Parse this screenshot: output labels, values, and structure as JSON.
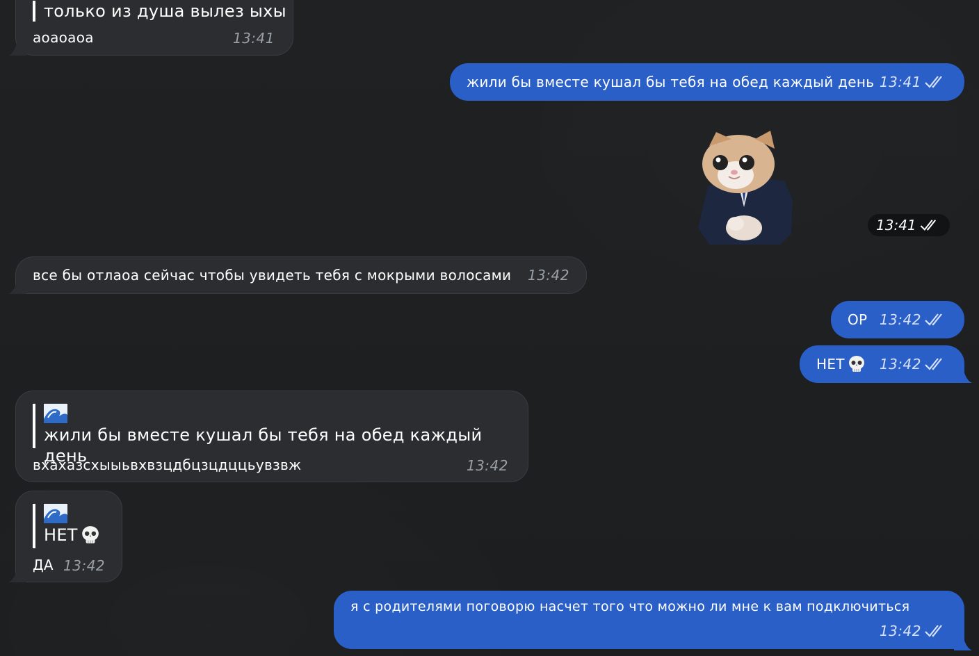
{
  "messages": [
    {
      "id": "m1",
      "dir": "in",
      "quote_text": "только из душа вылез ыхы",
      "text": "аоаоаоа",
      "time": "13:41"
    },
    {
      "id": "m2",
      "dir": "out",
      "text": "жили бы вместе кушал бы тебя на обед каждый день",
      "time": "13:41"
    },
    {
      "id": "m3",
      "dir": "out",
      "type": "sticker",
      "sticker": "cat-in-suit-sticker",
      "time": "13:41"
    },
    {
      "id": "m4",
      "dir": "in",
      "text": "все бы отлаоа сейчас чтобы увидеть тебя с мокрыми волосами",
      "time": "13:42"
    },
    {
      "id": "m5",
      "dir": "out",
      "text": "ОР",
      "time": "13:42"
    },
    {
      "id": "m6",
      "dir": "out",
      "text": "НЕТ",
      "emoji": "skull-emoji",
      "time": "13:42"
    },
    {
      "id": "m7",
      "dir": "in",
      "quote_emoji": "wave-emoji",
      "quote_text": "жили бы вместе кушал бы тебя на обед каждый день",
      "text": "вхахазсхыыьвхвзцдбцзцдццьувзвж",
      "time": "13:42"
    },
    {
      "id": "m8",
      "dir": "in",
      "quote_emoji": "wave-emoji",
      "quote_text": "НЕТ",
      "quote_trailing_emoji": "skull-emoji",
      "text": "ДА",
      "time": "13:42"
    },
    {
      "id": "m9",
      "dir": "out",
      "text": "я с родителями поговорю насчет того что можно ли мне к вам подключиться",
      "time": "13:42"
    }
  ],
  "colors": {
    "background": "#1e2022",
    "incoming": "#2b2d30",
    "outgoing": "#2a5fc8",
    "time_in": "#9aa0a8",
    "time_out": "#d6e2fb"
  },
  "icons": {
    "read_status": "double-check-icon"
  }
}
